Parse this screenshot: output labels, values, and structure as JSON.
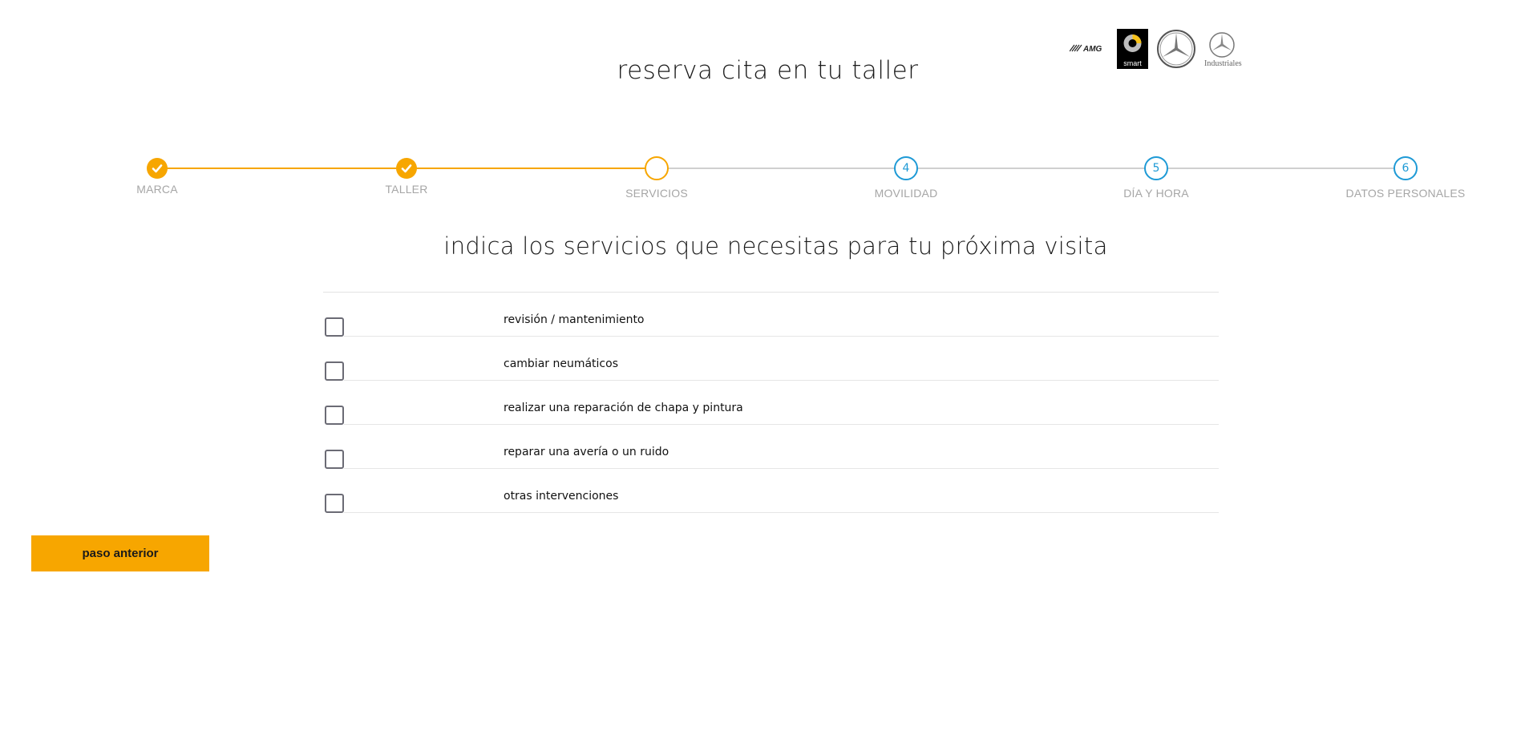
{
  "header": {
    "title": "reserva cita en tu taller",
    "brands": [
      {
        "name": "amg-logo-icon",
        "text": "AMG"
      },
      {
        "name": "smart-logo-icon",
        "text": "smart"
      },
      {
        "name": "mercedes-benz-logo-icon",
        "text": ""
      },
      {
        "name": "mercedes-industriales-logo-icon",
        "text": "Industriales"
      }
    ]
  },
  "stepper": {
    "steps": [
      {
        "number": "1",
        "label": "MARCA",
        "status": "done"
      },
      {
        "number": "2",
        "label": "TALLER",
        "status": "done"
      },
      {
        "number": "3",
        "label": "SERVICIOS",
        "status": "current"
      },
      {
        "number": "4",
        "label": "MOVILIDAD",
        "status": "todo"
      },
      {
        "number": "5",
        "label": "DÍA Y HORA",
        "status": "todo"
      },
      {
        "number": "6",
        "label": "DATOS PERSONALES",
        "status": "todo"
      }
    ],
    "colors": {
      "done": "#f7a600",
      "todo": "#1e9ad6",
      "track_inactive": "#d0d0d0"
    }
  },
  "main": {
    "section_title": "indica los servicios que necesitas para tu próxima visita",
    "services": [
      {
        "label": "revisión / mantenimiento",
        "checked": false
      },
      {
        "label": "cambiar neumáticos",
        "checked": false
      },
      {
        "label": "realizar una reparación de chapa y pintura",
        "checked": false
      },
      {
        "label": "reparar una avería o un ruido",
        "checked": false
      },
      {
        "label": "otras intervenciones",
        "checked": false
      }
    ]
  },
  "footer": {
    "back_label": "paso anterior"
  },
  "colors": {
    "accent": "#f7a600",
    "step_blue": "#1e9ad6"
  }
}
